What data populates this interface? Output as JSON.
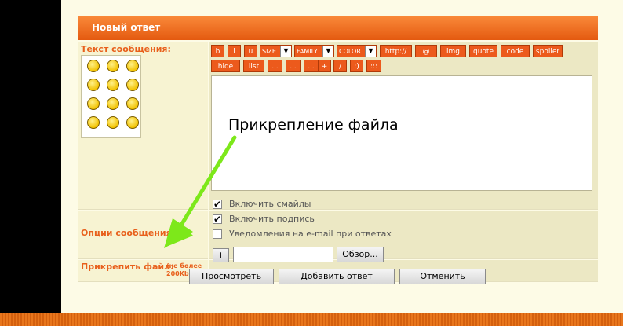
{
  "form": {
    "header": "Новый ответ",
    "message_label": "Текст сообщения:",
    "options_label": "Опции сообщения:",
    "attach_label": "Прикрепить файл:",
    "attach_hint": "(не более 200Kb)"
  },
  "toolbar": {
    "row1": [
      "b",
      "i",
      "u",
      "http://",
      "@",
      "img",
      "quote",
      "code",
      "spoiler"
    ],
    "row2": [
      "hide",
      "list",
      "...",
      "...",
      "...",
      "+",
      "/",
      ":)",
      ":::"
    ],
    "size": "SIZE",
    "family": "FAMILY",
    "color": "COLOR"
  },
  "options": [
    {
      "label": "Включить смайлы",
      "checked": true
    },
    {
      "label": "Включить подпись",
      "checked": true
    },
    {
      "label": "Уведомления на e-mail при ответах",
      "checked": false
    }
  ],
  "attach": {
    "add": "+",
    "browse": "Обзор...",
    "value": ""
  },
  "buttons": {
    "preview": "Просмотреть",
    "submit": "Добавить ответ",
    "cancel": "Отменить"
  },
  "annotation": "Прикрепление файла",
  "colors": {
    "accent": "#e8601c",
    "arrow": "#7de81a"
  }
}
